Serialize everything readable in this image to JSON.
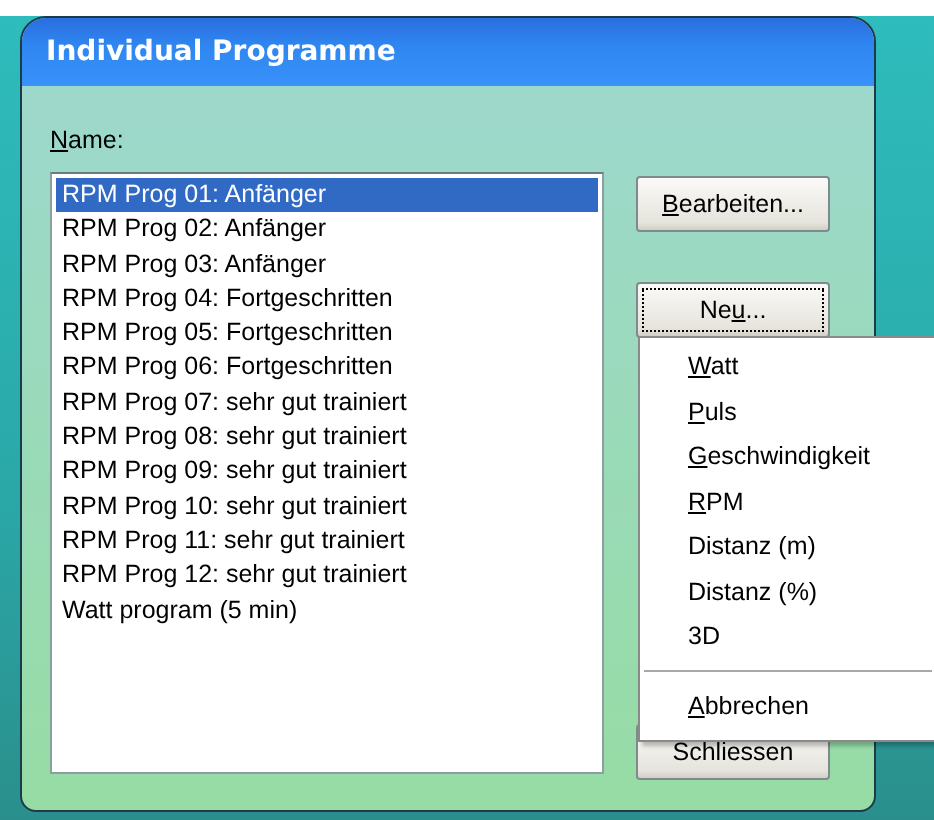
{
  "window": {
    "title": "Individual Programme"
  },
  "name_label": {
    "key": "N",
    "rest": "ame:"
  },
  "program_list": [
    {
      "label": "RPM Prog 01: Anfänger",
      "selected": true
    },
    {
      "label": "RPM Prog 02: Anfänger",
      "selected": false
    },
    {
      "label": "RPM Prog 03: Anfänger",
      "selected": false
    },
    {
      "label": "RPM Prog 04: Fortgeschritten",
      "selected": false
    },
    {
      "label": "RPM Prog 05: Fortgeschritten",
      "selected": false
    },
    {
      "label": "RPM Prog 06: Fortgeschritten",
      "selected": false
    },
    {
      "label": "RPM Prog 07: sehr gut trainiert",
      "selected": false
    },
    {
      "label": "RPM Prog 08: sehr gut trainiert",
      "selected": false
    },
    {
      "label": "RPM Prog 09: sehr gut trainiert",
      "selected": false
    },
    {
      "label": "RPM Prog 10: sehr gut trainiert",
      "selected": false
    },
    {
      "label": "RPM Prog 11: sehr gut trainiert",
      "selected": false
    },
    {
      "label": "RPM Prog 12: sehr gut trainiert",
      "selected": false
    },
    {
      "label": "Watt program (5 min)",
      "selected": false
    }
  ],
  "buttons": [
    {
      "key": "B",
      "rest": "earbeiten...",
      "focused": false
    },
    {
      "lead": "Ne",
      "key": "u",
      "rest": "...",
      "focused": true
    },
    {
      "lead": "Schliessen",
      "focused": false
    }
  ],
  "popup_menu": [
    {
      "kind": "item",
      "key": "W",
      "rest": "att"
    },
    {
      "kind": "item",
      "key": "P",
      "rest": "uls"
    },
    {
      "kind": "item",
      "key": "G",
      "rest": "eschwindigkeit"
    },
    {
      "kind": "item",
      "key": "R",
      "rest": "PM"
    },
    {
      "kind": "item",
      "lead": "Distanz (m)"
    },
    {
      "kind": "item",
      "lead": "Distanz (%)"
    },
    {
      "kind": "item",
      "lead": "3D"
    },
    {
      "kind": "separator"
    },
    {
      "kind": "item",
      "key": "A",
      "rest": "bbrechen"
    }
  ]
}
